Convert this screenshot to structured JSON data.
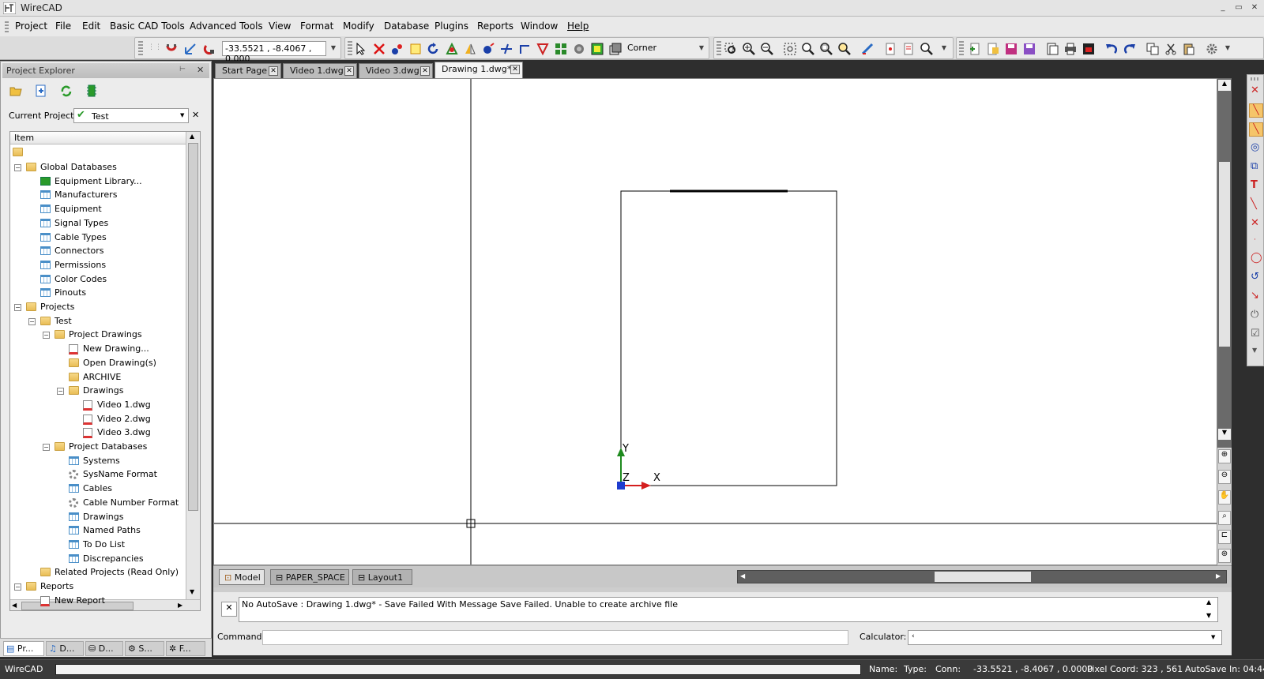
{
  "window": {
    "title": "WireCAD",
    "min": "_",
    "max": "▭",
    "close": "✕"
  },
  "menu": [
    "Project",
    "File",
    "Edit",
    "Basic CAD Tools",
    "Advanced Tools",
    "View",
    "Format",
    "Modify",
    "Database",
    "Plugins",
    "Reports",
    "Window",
    "Help"
  ],
  "toolbar": {
    "coord_readout": "-33.5521 , -8.4067 , 0.000",
    "snap_mode": "Corner"
  },
  "project_explorer": {
    "title": "Project Explorer",
    "pin": "📌",
    "close": "✕",
    "current_project_label": "Current Project:",
    "current_project_value": "Test",
    "tree_header": "Item",
    "nodes": [
      {
        "label": "Global Databases",
        "icon": "folder"
      },
      {
        "label": "Equipment Library...",
        "icon": "chip"
      },
      {
        "label": "Manufacturers",
        "icon": "table"
      },
      {
        "label": "Equipment",
        "icon": "table"
      },
      {
        "label": "Signal Types",
        "icon": "table"
      },
      {
        "label": "Cable Types",
        "icon": "table"
      },
      {
        "label": "Connectors",
        "icon": "table"
      },
      {
        "label": "Permissions",
        "icon": "table"
      },
      {
        "label": "Color Codes",
        "icon": "table"
      },
      {
        "label": "Pinouts",
        "icon": "table"
      },
      {
        "label": "Projects",
        "icon": "folder"
      },
      {
        "label": "Test",
        "icon": "folder"
      },
      {
        "label": "Project Drawings",
        "icon": "folder"
      },
      {
        "label": "New Drawing...",
        "icon": "dwg"
      },
      {
        "label": "Open Drawing(s)",
        "icon": "folder"
      },
      {
        "label": "ARCHIVE",
        "icon": "folder"
      },
      {
        "label": "Drawings",
        "icon": "folder"
      },
      {
        "label": "Video 1.dwg",
        "icon": "dwg"
      },
      {
        "label": "Video 2.dwg",
        "icon": "dwg"
      },
      {
        "label": "Video 3.dwg",
        "icon": "dwg"
      },
      {
        "label": "Project Databases",
        "icon": "folder"
      },
      {
        "label": "Systems",
        "icon": "table"
      },
      {
        "label": "SysName Format",
        "icon": "gear"
      },
      {
        "label": "Cables",
        "icon": "table"
      },
      {
        "label": "Cable Number Format",
        "icon": "gear"
      },
      {
        "label": "Drawings",
        "icon": "table"
      },
      {
        "label": "Named Paths",
        "icon": "table"
      },
      {
        "label": "To Do List",
        "icon": "table"
      },
      {
        "label": "Discrepancies",
        "icon": "table"
      },
      {
        "label": "Related Projects (Read Only)",
        "icon": "folder"
      },
      {
        "label": "Reports",
        "icon": "folder"
      },
      {
        "label": "New Report",
        "icon": "dwg"
      }
    ],
    "bottom_tabs": [
      "Pr...",
      "D...",
      "D...",
      "S...",
      "F..."
    ]
  },
  "doc_tabs": [
    "Start Page",
    "Video 1.dwg",
    "Video 3.dwg",
    "Drawing 1.dwg*"
  ],
  "canvas": {
    "axis_y": "Y",
    "axis_x": "X",
    "axis_z": "Z"
  },
  "layout_tabs": [
    "Model",
    "PAPER_SPACE",
    "Layout1"
  ],
  "command": {
    "message": "No AutoSave : Drawing 1.dwg* - Save Failed With Message Save Failed. Unable to create archive file",
    "command_label": "Command:",
    "calculator_label": "Calculator:",
    "calculator_value": "‹"
  },
  "status": {
    "app": "WireCAD",
    "name_label": "Name:",
    "type_label": "Type:",
    "conn_label": "Conn:",
    "coords": "-33.5521 , -8.4067 , 0.0000",
    "pixel_coord": "Pixel Coord: 323 , 561",
    "autosave": "AutoSave In: 04:44"
  }
}
